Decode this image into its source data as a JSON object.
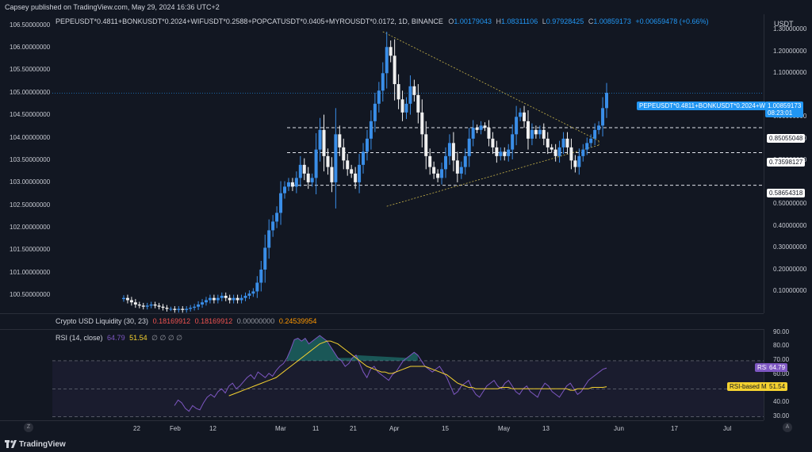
{
  "header": {
    "published": "Capsey published on TradingView.com, May 29, 2024 16:36 UTC+2"
  },
  "legend": {
    "symbol": "PEPEUSDT*0.4811+BONKUSDT*0.2024+WIFUSDT*0.2588+POPCATUSDT*0.0405+MYROUSDT*0.0172, 1D, BINANCE",
    "o_key": "O",
    "o_val": "1.00179043",
    "h_key": "H",
    "h_val": "1.08311106",
    "l_key": "L",
    "l_val": "0.97928425",
    "c_key": "C",
    "c_val": "1.00859173",
    "change": "+0.00659478 (+0.66%)"
  },
  "currency": "USDT",
  "liquidity": {
    "name": "Crypto USD Liquidity (30, 23)",
    "v1": "0.18169912",
    "v2": "0.18169912",
    "v3": "0.00000000",
    "v4": "0.24539954"
  },
  "rsi_legend": {
    "name": "RSI (14, close)",
    "rsi": "64.79",
    "ma": "51.54",
    "extra": "∅ ∅ ∅ ∅"
  },
  "price_tag": {
    "name": "PEPEUSDT*0.4811+BONKUSDT*0.2024+WIFUS...",
    "value": "1.00859173",
    "countdown": "08:23:01"
  },
  "level_tags": [
    "0.85055048",
    "0.73598127",
    "0.58654318"
  ],
  "rsi_tags": {
    "rsi_label": "RSI",
    "rsi_value": "64.79",
    "ma_label": "RSI-based MA",
    "ma_value": "51.54"
  },
  "left_axis_labels": [
    "106.50000000",
    "106.00000000",
    "105.50000000",
    "105.00000000",
    "104.50000000",
    "104.00000000",
    "103.50000000",
    "103.00000000",
    "102.50000000",
    "102.00000000",
    "101.50000000",
    "101.00000000",
    "100.50000000"
  ],
  "right_axis_labels": [
    "1.30000000",
    "1.20000000",
    "1.10000000",
    "0.90000000",
    "0.80000000",
    "0.70000000",
    "0.50000000",
    "0.40000000",
    "0.30000000",
    "0.20000000",
    "0.10000000"
  ],
  "rsi_axis_labels": [
    "90.00",
    "80.00",
    "70.00",
    "60.00",
    "40.00",
    "30.00"
  ],
  "x_axis_labels": [
    "22",
    "Feb",
    "12",
    "Mar",
    "11",
    "21",
    "Apr",
    "15",
    "May",
    "13",
    "Jun",
    "17",
    "Jul"
  ],
  "bottom": {
    "brand": "TradingView",
    "z_btn": "Z",
    "a_btn": "A"
  },
  "colors": {
    "up": "#3a8ee8",
    "down": "#f0f0f0",
    "bg": "#121722",
    "rsi_line": "#7e57c2",
    "rsi_ma": "#f5d230",
    "tag_blue": "#2196f3"
  },
  "chart_data": [
    {
      "type": "candlestick",
      "title": "PEPEUSDT*0.4811+BONKUSDT*0.2024+WIFUSDT*0.2588+POPCATUSDT*0.0405+MYROUSDT*0.0172, 1D, BINANCE",
      "y_axis": "USDT",
      "ylim": [
        0.0,
        1.37
      ],
      "x_ticks": [
        "22",
        "Feb",
        "12",
        "Mar",
        "11",
        "21",
        "Apr",
        "15",
        "May",
        "13",
        "Jun",
        "17",
        "Jul"
      ],
      "closes": [
        0.07,
        0.06,
        0.05,
        0.04,
        0.035,
        0.03,
        0.035,
        0.04,
        0.035,
        0.03,
        0.025,
        0.02,
        0.02,
        0.015,
        0.02,
        0.015,
        0.02,
        0.025,
        0.03,
        0.04,
        0.05,
        0.06,
        0.07,
        0.06,
        0.07,
        0.08,
        0.07,
        0.06,
        0.07,
        0.06,
        0.07,
        0.08,
        0.09,
        0.1,
        0.14,
        0.2,
        0.3,
        0.38,
        0.42,
        0.46,
        0.55,
        0.58,
        0.6,
        0.58,
        0.62,
        0.68,
        0.64,
        0.6,
        0.62,
        0.75,
        0.84,
        0.72,
        0.67,
        0.6,
        0.82,
        0.76,
        0.7,
        0.66,
        0.64,
        0.6,
        0.68,
        0.74,
        0.8,
        0.88,
        0.96,
        1.02,
        1.1,
        1.22,
        1.18,
        1.05,
        0.98,
        0.92,
        0.96,
        1.04,
        1.0,
        0.92,
        0.82,
        0.72,
        0.67,
        0.64,
        0.62,
        0.66,
        0.72,
        0.78,
        0.7,
        0.64,
        0.67,
        0.72,
        0.8,
        0.85,
        0.84,
        0.86,
        0.85,
        0.8,
        0.76,
        0.72,
        0.74,
        0.72,
        0.75,
        0.82,
        0.9,
        0.92,
        0.88,
        0.8,
        0.84,
        0.82,
        0.84,
        0.8,
        0.76,
        0.75,
        0.72,
        0.76,
        0.8,
        0.76,
        0.7,
        0.67,
        0.72,
        0.75,
        0.78,
        0.8,
        0.84,
        0.86,
        0.94,
        1.01
      ],
      "levels": [
        0.85055048,
        0.73598127,
        0.58654318
      ],
      "last": 1.00859173,
      "triangle": {
        "upper": [
          [
            66,
            1.29
          ],
          [
            121,
            0.79
          ]
        ],
        "lower": [
          [
            67,
            0.49
          ],
          [
            121,
            0.77
          ]
        ]
      }
    },
    {
      "type": "line",
      "title": "RSI (14, close)",
      "ylim": [
        27,
        92
      ],
      "bands": [
        30,
        50,
        70
      ],
      "series": [
        {
          "name": "RSI",
          "values": [
            38,
            42,
            40,
            36,
            34,
            38,
            36,
            35,
            40,
            44,
            46,
            44,
            48,
            50,
            47,
            52,
            54,
            50,
            52,
            55,
            58,
            60,
            57,
            62,
            60,
            58,
            61,
            59,
            63,
            66,
            68,
            72,
            78,
            85,
            86,
            84,
            86,
            82,
            84,
            86,
            88,
            86,
            84,
            80,
            76,
            72,
            70,
            66,
            68,
            72,
            74,
            68,
            62,
            58,
            64,
            66,
            62,
            60,
            58,
            56,
            60,
            62,
            66,
            70,
            72,
            74,
            76,
            74,
            70,
            66,
            64,
            62,
            64,
            66,
            62,
            58,
            52,
            46,
            48,
            52,
            54,
            56,
            50,
            46,
            44,
            48,
            52,
            54,
            56,
            52,
            50,
            54,
            56,
            52,
            48,
            46,
            50,
            52,
            48,
            46,
            44,
            50,
            54,
            52,
            48,
            46,
            44,
            48,
            52,
            54,
            50,
            46,
            48,
            52,
            56,
            58,
            60,
            62,
            64,
            64.79
          ]
        },
        {
          "name": "RSI-based MA",
          "values": [
            null,
            null,
            null,
            null,
            null,
            null,
            null,
            null,
            null,
            null,
            null,
            null,
            null,
            null,
            null,
            45,
            46,
            47,
            48,
            49,
            50,
            51,
            52,
            53,
            54,
            55,
            56,
            57,
            58,
            60,
            62,
            64,
            66,
            68,
            70,
            72,
            74,
            76,
            78,
            80,
            82,
            83,
            84,
            84,
            83,
            82,
            80,
            78,
            76,
            74,
            72,
            70,
            68,
            66,
            65,
            64,
            63,
            62,
            62,
            61,
            61,
            62,
            63,
            64,
            65,
            66,
            66,
            66,
            66,
            66,
            65,
            64,
            63,
            62,
            61,
            60,
            58,
            56,
            54,
            53,
            52,
            51,
            51,
            50,
            50,
            50,
            50,
            50,
            50,
            50,
            51,
            51,
            51,
            50,
            50,
            50,
            50,
            50,
            50,
            50,
            50,
            50,
            50,
            50,
            50,
            50,
            50,
            50,
            50,
            49,
            49,
            50,
            50,
            50,
            50,
            51,
            51,
            51,
            51,
            51.54
          ]
        }
      ]
    }
  ]
}
